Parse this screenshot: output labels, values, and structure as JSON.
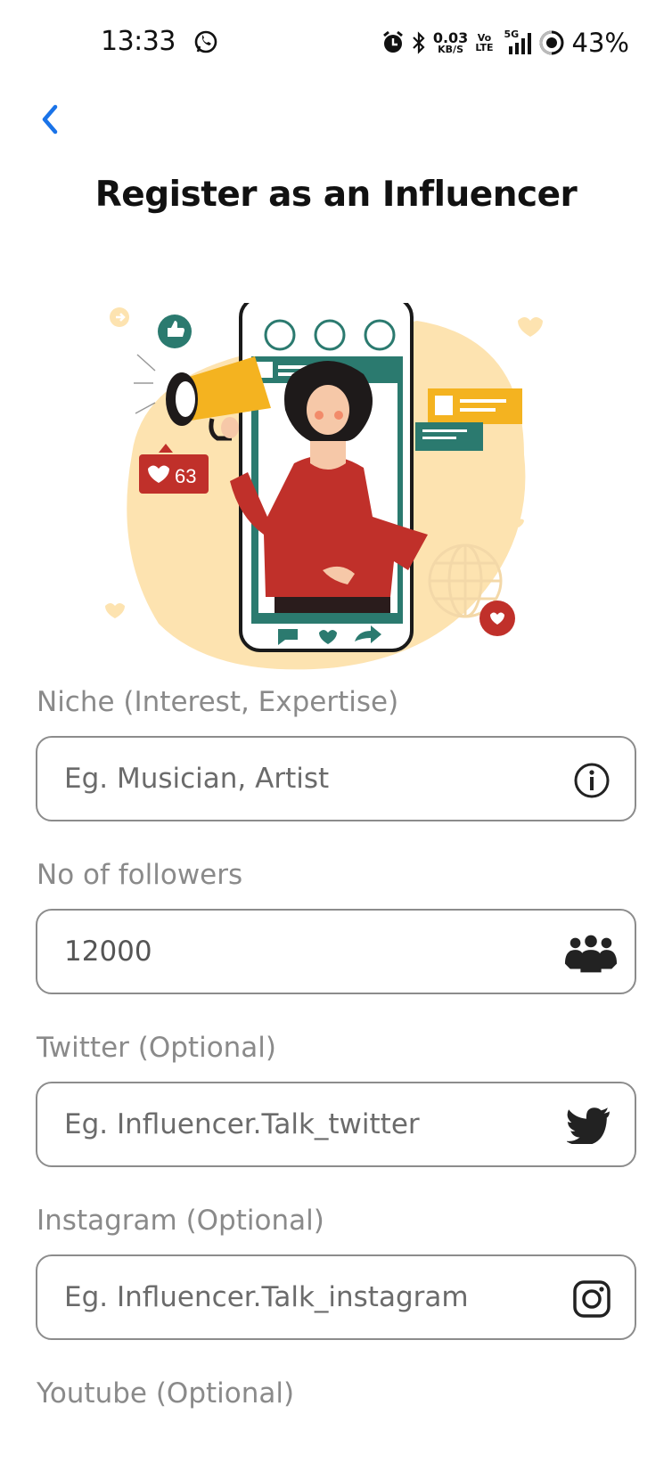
{
  "status_bar": {
    "time": "13:33",
    "net_speed_value": "0.03",
    "net_speed_unit": "KB/S",
    "volte_top": "Vo",
    "volte_bottom": "LTE",
    "network": "5G",
    "battery": "43%"
  },
  "page": {
    "title": "Register as an Influencer"
  },
  "illustration": {
    "like_count": "63"
  },
  "form": {
    "niche": {
      "label": "Niche (Interest, Expertise)",
      "placeholder": "Eg. Musician, Artist",
      "value": "",
      "icon": "info-icon"
    },
    "followers": {
      "label": "No of followers",
      "placeholder": "",
      "value": "12000",
      "icon": "group-icon"
    },
    "twitter": {
      "label": "Twitter (Optional)",
      "placeholder": "Eg. Influencer.Talk_twitter",
      "value": "",
      "icon": "twitter-icon"
    },
    "instagram": {
      "label": "Instagram (Optional)",
      "placeholder": "Eg. Influencer.Talk_instagram",
      "value": "",
      "icon": "instagram-icon"
    },
    "youtube": {
      "label": "Youtube (Optional)"
    }
  },
  "colors": {
    "accent": "#1a73e8",
    "teal": "#2b7a6f",
    "red": "#c0302a",
    "yellow": "#f4b320",
    "blob": "#fde3b0"
  }
}
